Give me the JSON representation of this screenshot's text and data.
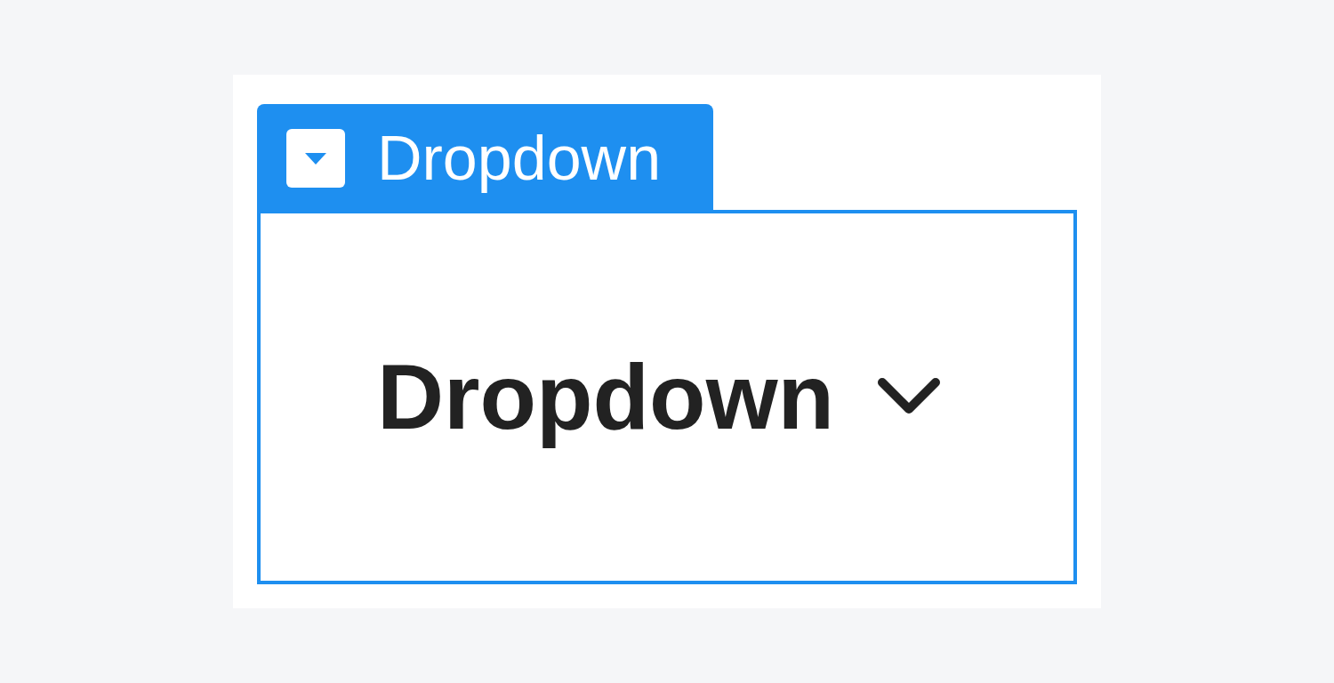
{
  "tag": {
    "label": "Dropdown"
  },
  "dropdown": {
    "label": "Dropdown"
  }
}
